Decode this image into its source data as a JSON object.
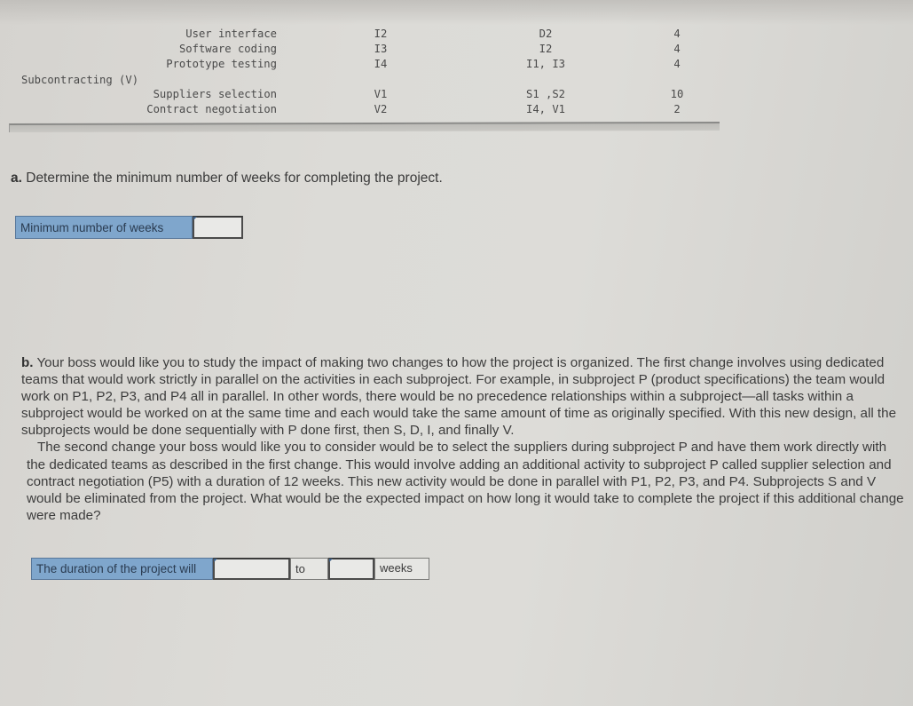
{
  "activity_table": {
    "rows": [
      {
        "description": "User interface",
        "activity": "I2",
        "predecessors": "D2",
        "time_weeks": "4"
      },
      {
        "description": "Software coding",
        "activity": "I3",
        "predecessors": "I2",
        "time_weeks": "4"
      },
      {
        "description": "Prototype testing",
        "activity": "I4",
        "predecessors": "I1, I3",
        "time_weeks": "4"
      },
      {
        "description": "Subcontracting (V)",
        "activity": "",
        "predecessors": "",
        "time_weeks": "",
        "is_group": true
      },
      {
        "description": "Suppliers selection",
        "activity": "V1",
        "predecessors": "S1 ,S2",
        "time_weeks": "10"
      },
      {
        "description": "Contract negotiation",
        "activity": "V2",
        "predecessors": "I4, V1",
        "time_weeks": "2"
      }
    ]
  },
  "part_a": {
    "letter": "a.",
    "question": " Determine the minimum number of weeks for completing the project.",
    "answer_label": "Minimum number of weeks",
    "answer_value": ""
  },
  "part_b": {
    "letter": "b.",
    "paragraph1": " Your boss would like you to study the impact of making two changes to how the project is organized. The first change involves using dedicated teams that would work strictly in parallel on the activities in each subproject. For example, in subproject P (product specifications) the team would work on P1, P2, P3, and P4 all in parallel. In other words, there would be no precedence relationships within a subproject—all tasks within a subproject would be worked on at the same time and each would take the same amount of time as originally specified. With this new design, all the subprojects would be done sequentially with P done first, then S, D, I, and finally V.",
    "paragraph2": "The second change your boss would like you to consider would be to select the suppliers during subproject P and have them work directly with the dedicated teams as described in the first change. This would involve adding an additional activity to subproject P called supplier selection and contract negotiation (P5) with a duration of 12 weeks. This new activity would be done in parallel with P1, P2, P3, and P4. Subprojects S and V would be eliminated from the project. What would be the expected impact on how long it would take to complete the project if this additional change were made?",
    "answer_label": "The duration of the project will",
    "answer_value_1": "",
    "connector": "to",
    "answer_value_2": "",
    "unit": "weeks"
  }
}
